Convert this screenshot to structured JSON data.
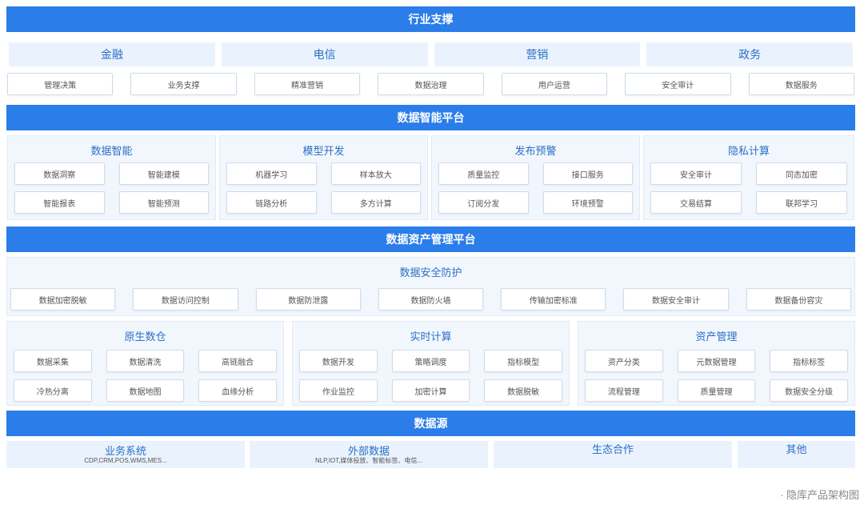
{
  "industry": {
    "title": "行业支撑",
    "verticals": [
      "金融",
      "电信",
      "营销",
      "政务"
    ],
    "apps": [
      "管理决策",
      "业务支撑",
      "精准营销",
      "数据治理",
      "用户运营",
      "安全审计",
      "数据服务"
    ]
  },
  "intelligence": {
    "title": "数据智能平台",
    "panels": [
      {
        "title": "数据智能",
        "items": [
          "数据洞察",
          "智能建模",
          "智能报表",
          "智能预测"
        ]
      },
      {
        "title": "模型开发",
        "items": [
          "机器学习",
          "样本放大",
          "链路分析",
          "多方计算"
        ]
      },
      {
        "title": "发布预警",
        "items": [
          "质量监控",
          "接口服务",
          "订阅分发",
          "环境预警"
        ]
      },
      {
        "title": "隐私计算",
        "items": [
          "安全审计",
          "同态加密",
          "交易结算",
          "联邦学习"
        ]
      }
    ]
  },
  "asset": {
    "title": "数据资产管理平台",
    "security": {
      "title": "数据安全防护",
      "items": [
        "数据加密脱敏",
        "数据访问控制",
        "数据防泄露",
        "数据防火墙",
        "传输加密标准",
        "数据安全审计",
        "数据备份容灾"
      ]
    },
    "panels": [
      {
        "title": "原生数仓",
        "items": [
          "数据采集",
          "数据清洗",
          "高链融合",
          "冷热分离",
          "数据地图",
          "血缘分析"
        ]
      },
      {
        "title": "实时计算",
        "items": [
          "数据开发",
          "策略调度",
          "指标模型",
          "作业监控",
          "加密计算",
          "数据脱敏"
        ]
      },
      {
        "title": "资产管理",
        "items": [
          "资产分类",
          "元数据管理",
          "指标标签",
          "流程管理",
          "质量管理",
          "数据安全分级"
        ]
      }
    ]
  },
  "source": {
    "title": "数据源",
    "boxes": [
      {
        "title": "业务系统",
        "sub": "CDP,CRM,POS,WMS,MES..."
      },
      {
        "title": "外部数据",
        "sub": "NLP,IOT,媒体投放、智能标签、电信..."
      },
      {
        "title": "生态合作",
        "sub": ""
      },
      {
        "title": "其他",
        "sub": ""
      }
    ]
  },
  "caption": "· 隐库产品架构图"
}
